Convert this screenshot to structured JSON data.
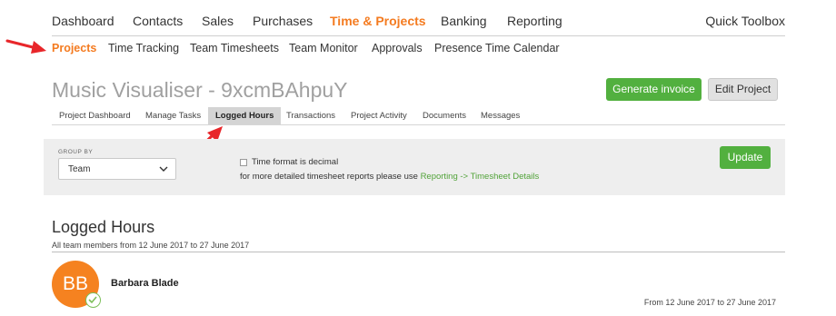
{
  "topnav": {
    "items": [
      {
        "label": "Dashboard"
      },
      {
        "label": "Contacts"
      },
      {
        "label": "Sales"
      },
      {
        "label": "Purchases"
      },
      {
        "label": "Time & Projects"
      },
      {
        "label": "Banking"
      },
      {
        "label": "Reporting"
      }
    ],
    "active_index": 4,
    "toolbox_label": "Quick Toolbox"
  },
  "subnav": {
    "items": [
      {
        "label": "Projects"
      },
      {
        "label": "Time Tracking"
      },
      {
        "label": "Team Timesheets"
      },
      {
        "label": "Team Monitor"
      },
      {
        "label": "Approvals"
      },
      {
        "label": "Presence Time Calendar"
      }
    ],
    "active_index": 0
  },
  "project": {
    "title": "Music Visualiser - 9xcmBAhpuY",
    "generate_invoice_label": "Generate invoice",
    "edit_project_label": "Edit Project"
  },
  "project_tabs": {
    "items": [
      {
        "label": "Project Dashboard"
      },
      {
        "label": "Manage Tasks"
      },
      {
        "label": "Logged Hours"
      },
      {
        "label": "Transactions"
      },
      {
        "label": "Project Activity"
      },
      {
        "label": "Documents"
      },
      {
        "label": "Messages"
      }
    ],
    "active_index": 2
  },
  "filter": {
    "group_by_label": "GROUP BY",
    "group_by_value": "Team",
    "decimal_label": "Time format is decimal",
    "decimal_checked": false,
    "note_text": "for more detailed timesheet reports please use",
    "note_link": "Reporting -> Timesheet Details",
    "update_label": "Update"
  },
  "logged_hours": {
    "title": "Logged Hours",
    "subtitle": "All team members from 12 June 2017 to 27 June 2017",
    "members": [
      {
        "initials": "BB",
        "name": "Barbara Blade",
        "range": "From 12 June 2017 to 27 June 2017"
      }
    ]
  },
  "colors": {
    "accent": "#f47b20",
    "green": "#52b03f",
    "arrow": "#e8262a",
    "avatar": "#f58220"
  },
  "icons": {
    "select": "chevron-down-icon",
    "avatar_status": "checkmark-icon",
    "annotation": "red-arrow-icon"
  }
}
